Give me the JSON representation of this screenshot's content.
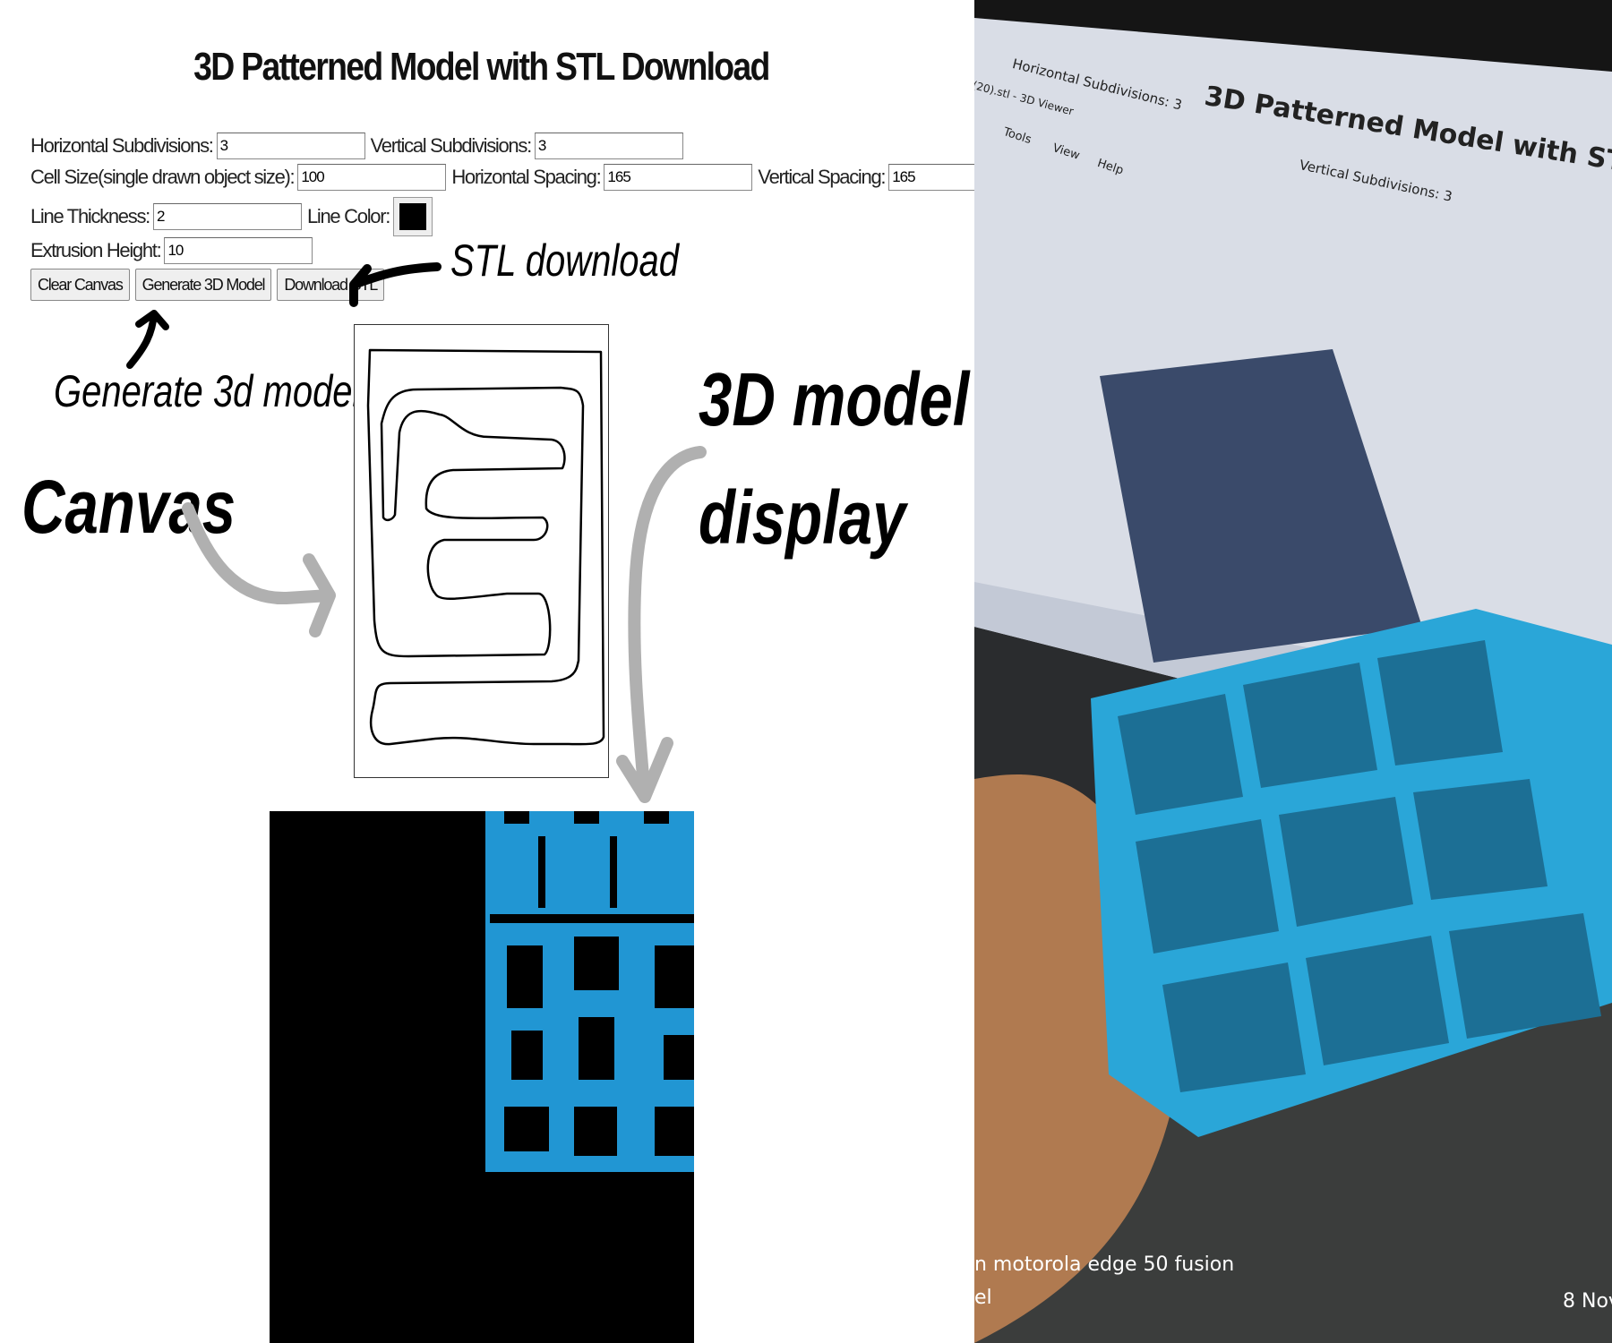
{
  "title": "3D Patterned Model with STL Download",
  "controls": {
    "horizontal_subdivisions": {
      "label": "Horizontal Subdivisions:",
      "value": "3"
    },
    "vertical_subdivisions": {
      "label": "Vertical Subdivisions:",
      "value": "3"
    },
    "cell_size": {
      "label": "Cell Size(single drawn object size):",
      "value": "100"
    },
    "horizontal_spacing": {
      "label": "Horizontal Spacing:",
      "value": "165"
    },
    "vertical_spacing": {
      "label": "Vertical Spacing:",
      "value": "165"
    },
    "line_thickness": {
      "label": "Line Thickness:",
      "value": "2"
    },
    "line_color": {
      "label": "Line Color:",
      "value": "#000000"
    },
    "extrusion_height": {
      "label": "Extrusion Height:",
      "value": "10"
    }
  },
  "buttons": {
    "clear": "Clear Canvas",
    "generate": "Generate 3D Model",
    "download": "Download STL"
  },
  "annotations": {
    "stl_download": "STL download",
    "generate_model": "Generate 3d model",
    "canvas": "Canvas",
    "model_display_1": "3D model",
    "model_display_2": "display"
  },
  "colors": {
    "model": "#2196d3",
    "background": "#000000",
    "arrow_gray": "#b0b0b0"
  },
  "photo": {
    "screen_title": "3D Patterned Model with STL Dow",
    "screen_h_subdiv": "Horizontal Subdivisions: 3",
    "screen_v_subdiv": "Vertical Subdivisions: 3",
    "viewer_title": "(20).stl - 3D Viewer",
    "menu": [
      "Tools",
      "View",
      "Help"
    ],
    "watermark_line1": "n motorola edge 50 fusion",
    "watermark_line2": "el",
    "date": "8 Nov"
  }
}
